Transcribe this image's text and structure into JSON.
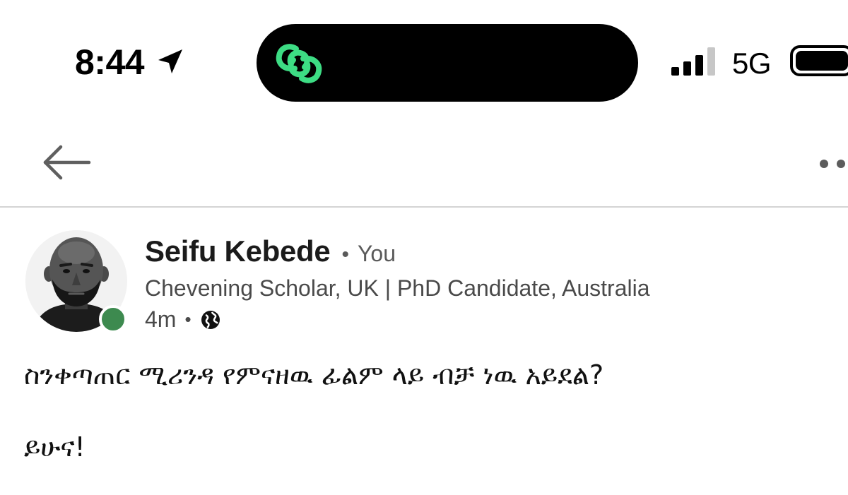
{
  "status_bar": {
    "time": "8:44",
    "location_icon": "location-arrow-icon",
    "island_icon": "chain-link-icon",
    "island_icon_color": "#3ddc84",
    "signal_icon": "cellular-signal-icon",
    "network": "5G",
    "battery_icon": "battery-full-icon"
  },
  "nav": {
    "back_icon": "arrow-left-icon",
    "more_icon": "more-dots-icon"
  },
  "post": {
    "author": {
      "name": "Seifu Kebede",
      "relation": "You",
      "headline": "Chevening Scholar, UK | PhD Candidate, Australia",
      "avatar": "avatar-photo",
      "online": true,
      "online_color": "#3d8a4f"
    },
    "separator": "•",
    "age": "4m",
    "visibility_icon": "globe-icon",
    "body_lines": [
      "ስንቀጣጠር ሚሪንዳ የምናዘዉ ፊልም ላይ ብቻ ነዉ አይደል?",
      "ይሁና!"
    ]
  }
}
